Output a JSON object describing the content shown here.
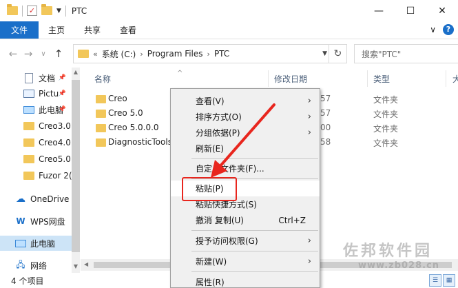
{
  "window": {
    "title": "PTC",
    "minimize": "—",
    "maximize": "☐",
    "close": "✕"
  },
  "ribbon": {
    "tabs": [
      "文件",
      "主页",
      "共享",
      "查看"
    ],
    "expand": "∨",
    "help": "?"
  },
  "nav": {
    "back": "←",
    "forward": "→",
    "recent": "∨",
    "up": "↑"
  },
  "address": {
    "prefix": "«",
    "crumbs": [
      "系统 (C:)",
      "Program Files",
      "PTC"
    ],
    "separator": "›",
    "refresh": "↻"
  },
  "search": {
    "placeholder": "搜索\"PTC\""
  },
  "sidebar": {
    "items": [
      {
        "label": "文档",
        "icon": "doc",
        "pinned": true
      },
      {
        "label": "Pictu",
        "icon": "pic",
        "pinned": true
      },
      {
        "label": "此电脑",
        "icon": "pc",
        "pinned": true
      },
      {
        "label": "Creo3.0",
        "icon": "folder",
        "pinned": false
      },
      {
        "label": "Creo4.0",
        "icon": "folder",
        "pinned": false
      },
      {
        "label": "Creo5.0",
        "icon": "folder",
        "pinned": false
      },
      {
        "label": "Fuzor 2(",
        "icon": "folder",
        "pinned": false
      },
      {
        "label": "OneDrive",
        "icon": "cloud",
        "pinned": false
      },
      {
        "label": "WPS网盘",
        "icon": "wps",
        "pinned": false
      },
      {
        "label": "此电脑",
        "icon": "pc",
        "pinned": false
      },
      {
        "label": "网络",
        "icon": "net",
        "pinned": false
      }
    ]
  },
  "columns": {
    "name": "名称",
    "date": "修改日期",
    "type": "类型",
    "size": "大"
  },
  "files": [
    {
      "name": "Creo",
      "date": "57",
      "type": "文件夹"
    },
    {
      "name": "Creo 5.0",
      "date": "57",
      "type": "文件夹"
    },
    {
      "name": "Creo 5.0.0.0",
      "date": "00",
      "type": "文件夹"
    },
    {
      "name": "DiagnosticTools",
      "date": "58",
      "type": "文件夹"
    }
  ],
  "status": {
    "count": "4 个项目"
  },
  "context_menu": {
    "items": [
      {
        "label": "查看(V)",
        "submenu": true
      },
      {
        "label": "排序方式(O)",
        "submenu": true
      },
      {
        "label": "分组依据(P)",
        "submenu": true
      },
      {
        "label": "刷新(E)",
        "submenu": false
      },
      {
        "label": "自定义文件夹(F)...",
        "submenu": false
      },
      {
        "label": "粘贴(P)",
        "submenu": false
      },
      {
        "label": "粘贴快捷方式(S)",
        "submenu": false
      },
      {
        "label": "撤消 复制(U)",
        "submenu": false,
        "shortcut": "Ctrl+Z"
      },
      {
        "label": "授予访问权限(G)",
        "submenu": true
      },
      {
        "label": "新建(W)",
        "submenu": true
      },
      {
        "label": "属性(R)",
        "submenu": false
      }
    ]
  },
  "annotation": {
    "color": "#e8261e"
  },
  "watermark": {
    "text": "佐邦软件园",
    "url": "www.zb028.cn"
  }
}
